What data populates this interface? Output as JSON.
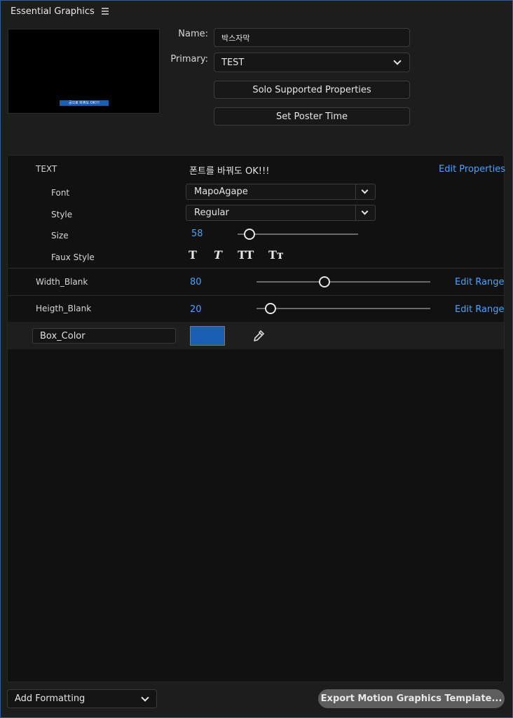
{
  "panel": {
    "title": "Essential Graphics"
  },
  "preview": {
    "caption": "공으로 바꿔도 OK!!!"
  },
  "name_field": {
    "label": "Name:",
    "value": "박스자막"
  },
  "primary": {
    "label": "Primary:",
    "value": "TEST"
  },
  "buttons": {
    "solo": "Solo Supported Properties",
    "poster": "Set Poster Time"
  },
  "text_group": {
    "label": "TEXT",
    "value": "폰트를 바꿔도 OK!!!",
    "edit_link": "Edit Properties",
    "font": {
      "label": "Font",
      "value": "MapoAgape"
    },
    "style": {
      "label": "Style",
      "value": "Regular"
    },
    "size": {
      "label": "Size",
      "value": "58",
      "slider_fraction": 0.1
    },
    "faux": {
      "label": "Faux Style",
      "bold": "T",
      "italic": "T",
      "allcaps": "TT",
      "smallcaps": "Tт"
    }
  },
  "width_blank": {
    "label": "Width_Blank",
    "value": "80",
    "edit_link": "Edit Range",
    "slider_fraction": 0.39
  },
  "height_blank": {
    "label": "Heigth_Blank",
    "value": "20",
    "edit_link": "Edit Range",
    "slider_fraction": 0.08
  },
  "box_color": {
    "label": "Box_Color",
    "color": "#1a5fb4"
  },
  "footer": {
    "add_formatting": "Add Formatting",
    "export": "Export Motion Graphics Template..."
  },
  "colors": {
    "accent": "#4aa3ff",
    "panel_bg": "#111111",
    "window_bg": "#1d1d1d"
  }
}
